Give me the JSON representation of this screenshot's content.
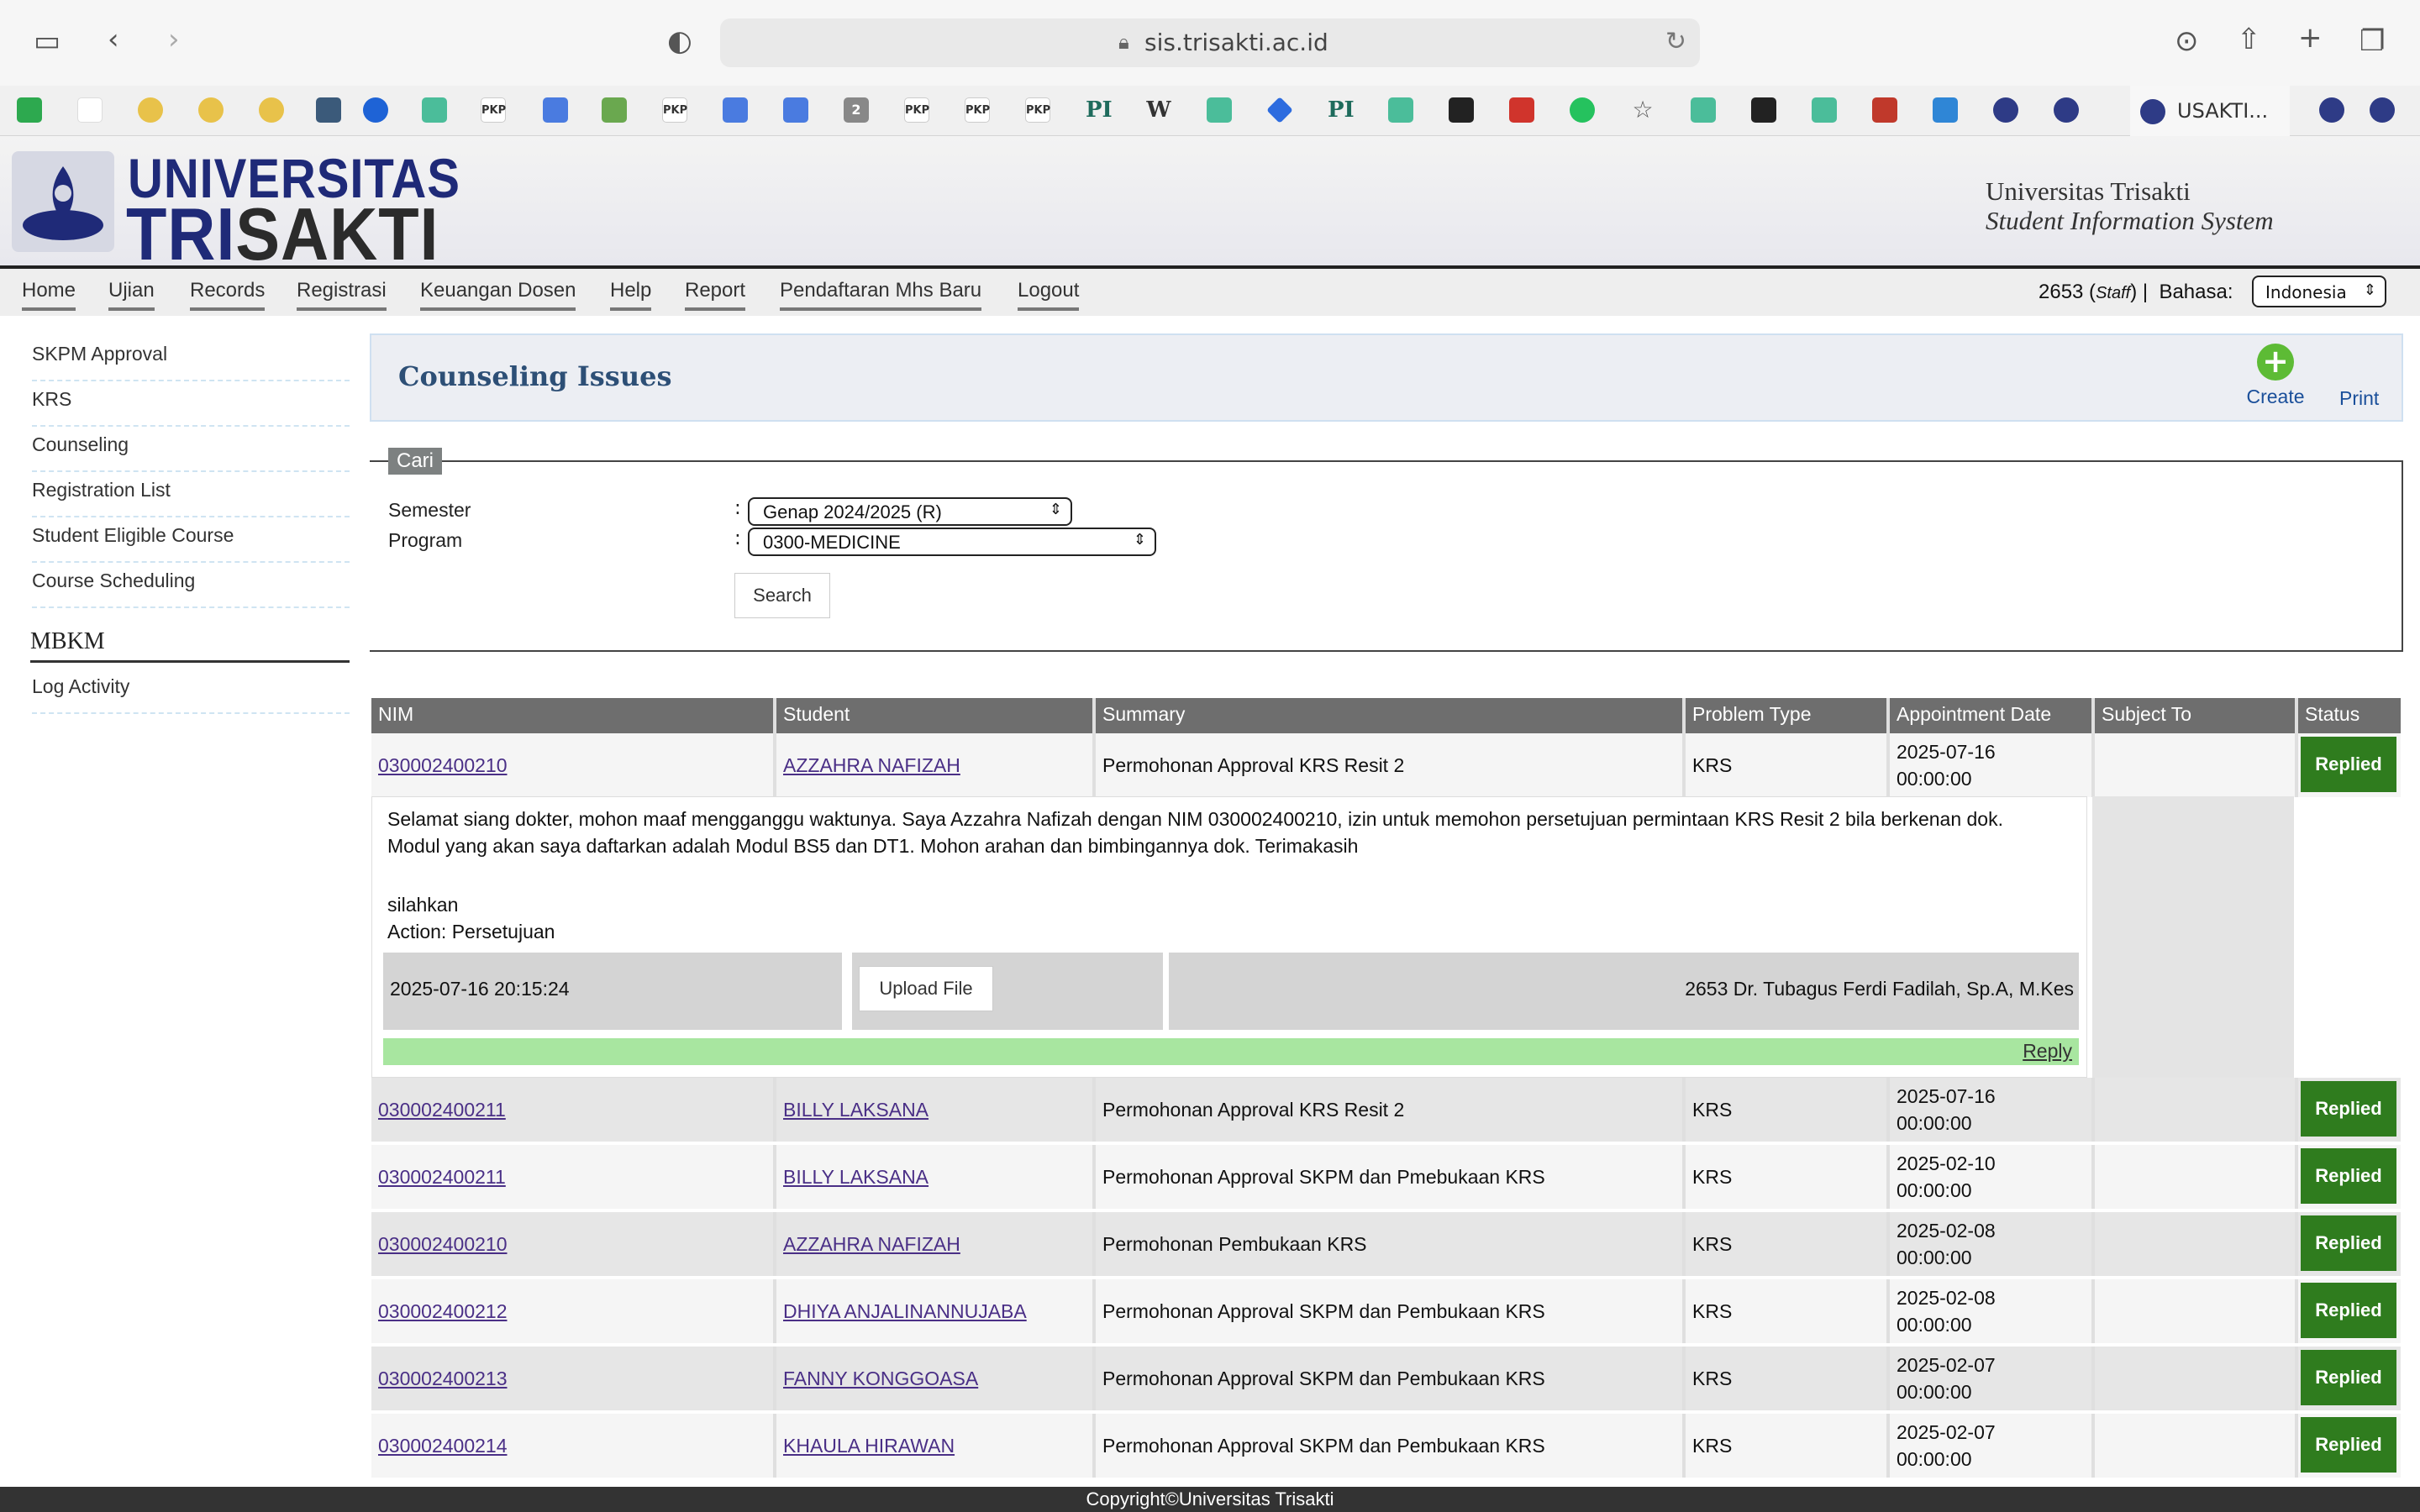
{
  "browser": {
    "url": "sis.trisakti.ac.id",
    "tab_title": "USAKTI...",
    "bookmark_labels": [
      "PKP",
      "PKP",
      "PKP",
      "PKP",
      "PKP",
      "PKP",
      "PI",
      "W",
      "PI",
      "2"
    ]
  },
  "header": {
    "logo_line1": "UNIVERSITAS",
    "logo_line2_a": "TRI",
    "logo_line2_b": "SAKTI",
    "system_title": "Universitas Trisakti",
    "system_subtitle": "Student Information System"
  },
  "nav": {
    "items": [
      "Home",
      "Ujian",
      "Records",
      "Registrasi",
      "Keuangan Dosen",
      "Help",
      "Report",
      "Pendaftaran Mhs Baru",
      "Logout"
    ],
    "user_id": "2653",
    "user_role": "Staff",
    "lang_label": "Bahasa:",
    "lang_value": "Indonesia"
  },
  "sidebar": {
    "items": [
      "SKPM Approval",
      "KRS",
      "Counseling",
      "Registration List",
      "Student Eligible Course",
      "Course Scheduling"
    ],
    "heading": "MBKM",
    "mbkm_items": [
      "Log Activity"
    ]
  },
  "page": {
    "title": "Counseling Issues",
    "create_label": "Create",
    "print_label": "Print"
  },
  "search": {
    "legend": "Cari",
    "semester_label": "Semester",
    "semester_value": "Genap 2024/2025 (R)",
    "program_label": "Program",
    "program_value": "0300-MEDICINE",
    "button": "Search"
  },
  "table": {
    "columns": [
      "NIM",
      "Student",
      "Summary",
      "Problem Type",
      "Appointment Date",
      "Subject To",
      "Status"
    ],
    "rows": [
      {
        "nim": "030002400210",
        "student": "AZZAHRA NAFIZAH",
        "summary": "Permohonan Approval KRS Resit 2",
        "type": "KRS",
        "date1": "2025-07-16",
        "date2": "00:00:00",
        "subject": "",
        "status": "Replied"
      },
      {
        "nim": "030002400211",
        "student": "BILLY LAKSANA",
        "summary": "Permohonan Approval KRS Resit 2",
        "type": "KRS",
        "date1": "2025-07-16",
        "date2": "00:00:00",
        "subject": "",
        "status": "Replied"
      },
      {
        "nim": "030002400211",
        "student": "BILLY LAKSANA",
        "summary": "Permohonan Approval SKPM dan Pmebukaan KRS",
        "type": "KRS",
        "date1": "2025-02-10",
        "date2": "00:00:00",
        "subject": "",
        "status": "Replied"
      },
      {
        "nim": "030002400210",
        "student": "AZZAHRA NAFIZAH",
        "summary": "Permohonan Pembukaan KRS",
        "type": "KRS",
        "date1": "2025-02-08",
        "date2": "00:00:00",
        "subject": "",
        "status": "Replied"
      },
      {
        "nim": "030002400212",
        "student": "DHIYA ANJALINANNUJABA",
        "summary": "Permohonan Approval SKPM dan Pembukaan KRS",
        "type": "KRS",
        "date1": "2025-02-08",
        "date2": "00:00:00",
        "subject": "",
        "status": "Replied"
      },
      {
        "nim": "030002400213",
        "student": "FANNY KONGGOASA",
        "summary": "Permohonan Approval SKPM dan Pembukaan KRS",
        "type": "KRS",
        "date1": "2025-02-07",
        "date2": "00:00:00",
        "subject": "",
        "status": "Replied"
      },
      {
        "nim": "030002400214",
        "student": "KHAULA HIRAWAN",
        "summary": "Permohonan Approval SKPM dan Pembukaan KRS",
        "type": "KRS",
        "date1": "2025-02-07",
        "date2": "00:00:00",
        "subject": "",
        "status": "Replied"
      }
    ]
  },
  "detail": {
    "message": "Selamat siang dokter, mohon maaf mengganggu waktunya. Saya Azzahra Nafizah dengan NIM 030002400210, izin untuk memohon persetujuan permintaan KRS Resit 2 bila berkenan dok. Modul yang akan saya daftarkan adalah Modul BS5 dan DT1. Mohon arahan dan bimbingannya dok. Terimakasih",
    "reply": "silahkan",
    "action": "Action: Persetujuan",
    "timestamp": "2025-07-16 20:15:24",
    "upload_label": "Upload File",
    "responder": "2653 Dr. Tubagus Ferdi Fadilah, Sp.A, M.Kes",
    "reply_link": "Reply"
  },
  "footer": {
    "copyright": "Copyright©Universitas Trisakti"
  },
  "colors": {
    "header_bar": "#6e6e6e",
    "status_green": "#2f7c1e",
    "reply_green": "#a8e6a0",
    "title_blue": "#2d4f76",
    "logo_blue": "#1f2a78"
  }
}
